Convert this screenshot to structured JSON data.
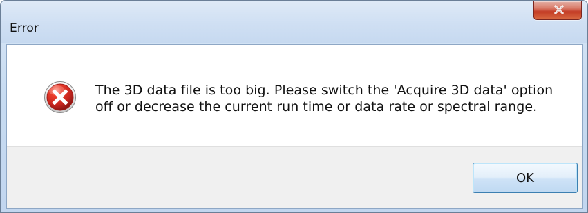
{
  "window": {
    "title": "Error"
  },
  "titlebar": {
    "close_icon": "close-icon"
  },
  "message": {
    "icon": "error-icon",
    "line_1": "The 3D data file is too big. Please switch the 'Acquire 3D data' option",
    "line_2": "off or decrease the current run time or data rate or spectral range."
  },
  "buttons": {
    "ok_label": "OK"
  },
  "colors": {
    "close_button": "#c33b25",
    "error_icon": "#c7261f",
    "dialog_footer": "#f0f0f0",
    "ok_border": "#3c7fb1"
  }
}
